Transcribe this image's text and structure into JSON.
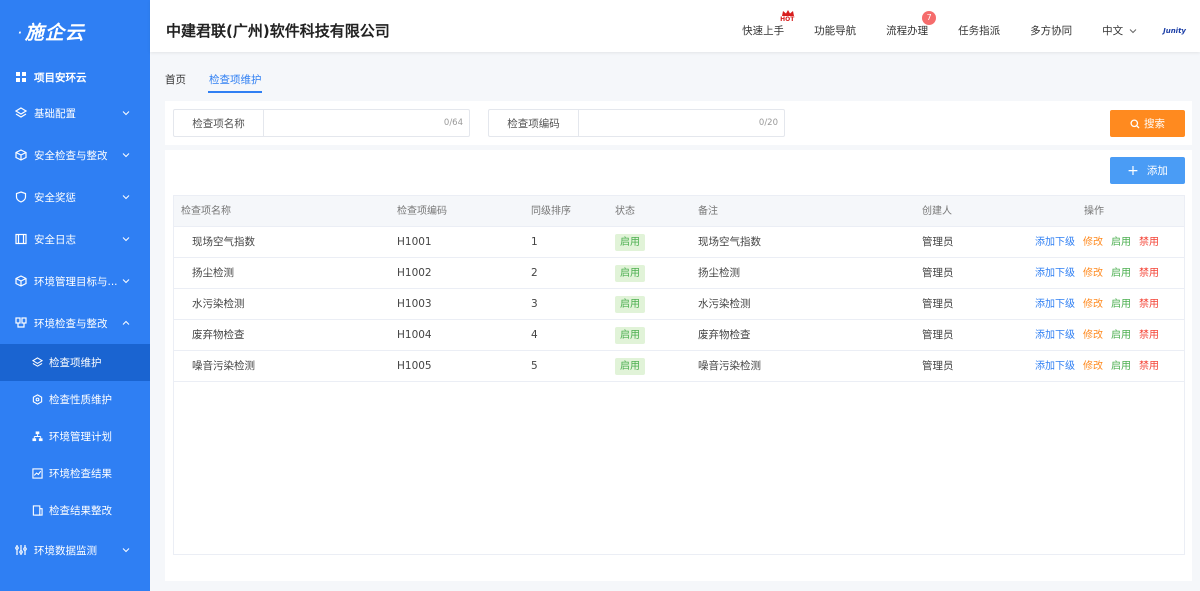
{
  "logo": "施企云",
  "company": "中建君联(广州)软件科技有限公司",
  "top_nav": {
    "quick_start": "快速上手",
    "hot": "HOT",
    "feature_nav": "功能导航",
    "process": "流程办理",
    "process_badge": "7",
    "task": "任务指派",
    "collab": "多方协同",
    "lang": "中文",
    "brand": "Junity"
  },
  "sidebar": {
    "items": [
      {
        "label": "项目安环云"
      },
      {
        "label": "基础配置"
      },
      {
        "label": "安全检查与整改"
      },
      {
        "label": "安全奖惩"
      },
      {
        "label": "安全日志"
      },
      {
        "label": "环境管理目标与..."
      },
      {
        "label": "环境检查与整改"
      },
      {
        "label": "环境数据监测"
      }
    ],
    "sub_items": [
      {
        "label": "检查项维护"
      },
      {
        "label": "检查性质维护"
      },
      {
        "label": "环境管理计划"
      },
      {
        "label": "环境检查结果"
      },
      {
        "label": "检查结果整改"
      }
    ]
  },
  "tabs": {
    "home": "首页",
    "current": "检查项维护"
  },
  "search": {
    "name_label": "检查项名称",
    "name_count": "0/64",
    "code_label": "检查项编码",
    "code_count": "0/20",
    "button": "搜索"
  },
  "add_button": "添加",
  "table": {
    "headers": [
      "检查项名称",
      "检查项编码",
      "同级排序",
      "状态",
      "备注",
      "创建人",
      "操作"
    ],
    "rows": [
      {
        "name": "现场空气指数",
        "code": "H1001",
        "order": "1",
        "status": "启用",
        "remark": "现场空气指数",
        "creator": "管理员"
      },
      {
        "name": "扬尘检测",
        "code": "H1002",
        "order": "2",
        "status": "启用",
        "remark": "扬尘检测",
        "creator": "管理员"
      },
      {
        "name": "水污染检测",
        "code": "H1003",
        "order": "3",
        "status": "启用",
        "remark": "水污染检测",
        "creator": "管理员"
      },
      {
        "name": "废弃物检查",
        "code": "H1004",
        "order": "4",
        "status": "启用",
        "remark": "废弃物检查",
        "creator": "管理员"
      },
      {
        "name": "噪音污染检测",
        "code": "H1005",
        "order": "5",
        "status": "启用",
        "remark": "噪音污染检测",
        "creator": "管理员"
      }
    ],
    "ops": {
      "add_child": "添加下级",
      "edit": "修改",
      "enable": "启用",
      "disable": "禁用"
    }
  },
  "colors": {
    "sidebar": "#2f7ff3",
    "active": "#1a64d1",
    "search": "#ff8a1f",
    "add": "#4a9cf5"
  }
}
